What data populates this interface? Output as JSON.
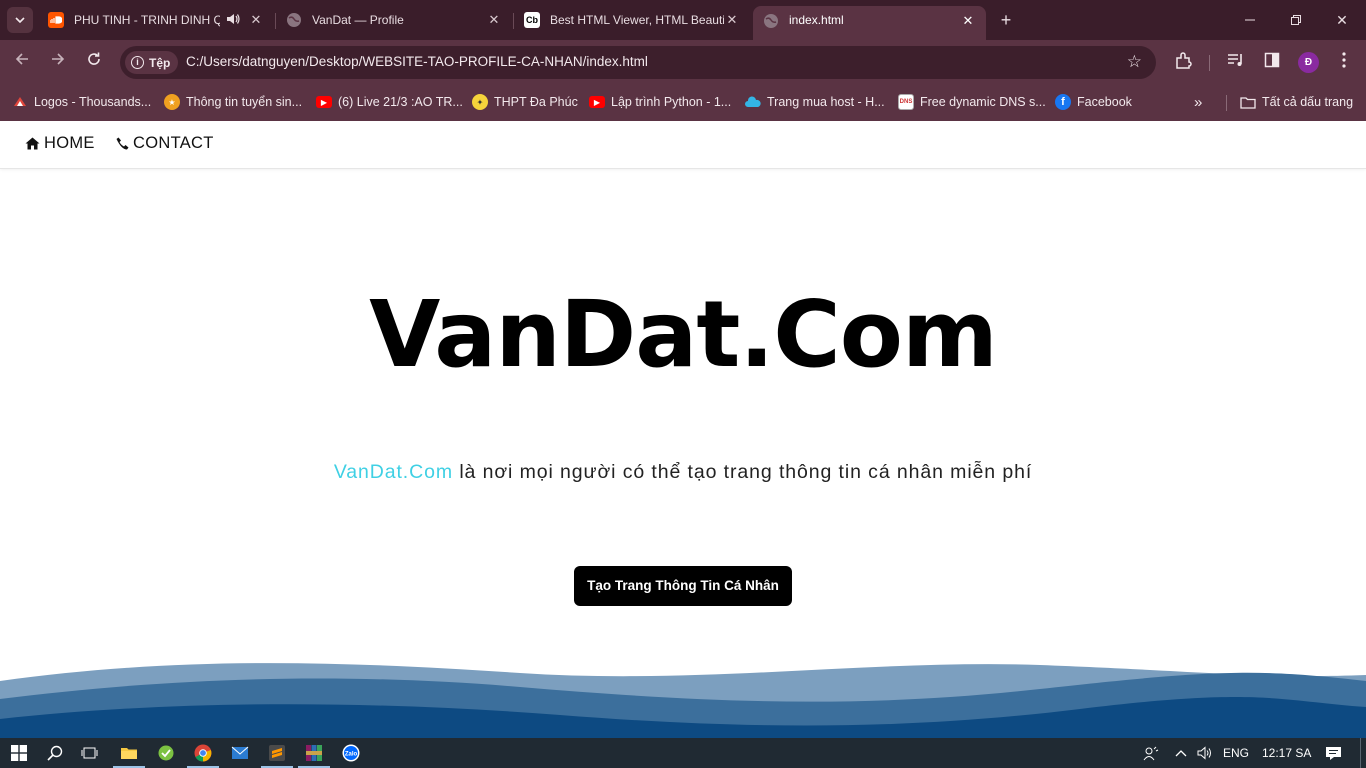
{
  "browser": {
    "tabs": [
      {
        "title": "PHU TINH - TRINH DINH QUANG",
        "favicon": "soundcloud-icon",
        "audio": true,
        "active": false
      },
      {
        "title": "VanDat — Profile",
        "favicon": "globe-icon",
        "active": false
      },
      {
        "title": "Best HTML Viewer, HTML Beautifier",
        "favicon": "codebeautify-icon",
        "active": false
      },
      {
        "title": "index.html",
        "favicon": "globe-icon",
        "active": true
      }
    ],
    "address": {
      "chip_label": "Tệp",
      "url": "C:/Users/datnguyen/Desktop/WEBSITE-TAO-PROFILE-CA-NHAN/index.html"
    },
    "profile_initial": "Đ",
    "bookmarks": [
      {
        "label": "Logos - Thousands...",
        "icon": "logos-icon"
      },
      {
        "label": "Thông tin tuyển sin...",
        "icon": "school-icon"
      },
      {
        "label": "(6) Live 21/3 :AO TR...",
        "icon": "youtube-icon"
      },
      {
        "label": "THPT Đa Phúc",
        "icon": "school-crest-icon"
      },
      {
        "label": "Lập trình Python - 1...",
        "icon": "youtube-icon"
      },
      {
        "label": "Trang mua host - H...",
        "icon": "cloud-icon"
      },
      {
        "label": "Free dynamic DNS s...",
        "icon": "dns-icon"
      },
      {
        "label": "Facebook",
        "icon": "facebook-icon"
      }
    ],
    "all_bookmarks_label": "Tất cả dấu trang"
  },
  "site": {
    "nav": {
      "home_label": "HOME",
      "contact_label": "CONTACT"
    },
    "logo_text": "VanDat.Com",
    "tagline_brand": "VanDat.Com",
    "tagline_rest": " là nơi mọi người có thể tạo trang thông tin cá nhân miễn phí",
    "cta_label": "Tạo Trang Thông Tin Cá Nhân",
    "colors": {
      "brand_accent": "#3fd0e4",
      "wave_dark": "#0d4a82",
      "wave_mid": "#3c6f9c",
      "wave_light": "#7c9fbf"
    }
  },
  "taskbar": {
    "language": "ENG",
    "time": "12:17 SA",
    "apps": [
      "windows-start-icon",
      "search-icon",
      "task-view-icon",
      "file-explorer-icon",
      "app-icon",
      "chrome-icon",
      "mail-icon",
      "sublime-text-icon",
      "winrar-icon",
      "zalo-icon"
    ]
  }
}
